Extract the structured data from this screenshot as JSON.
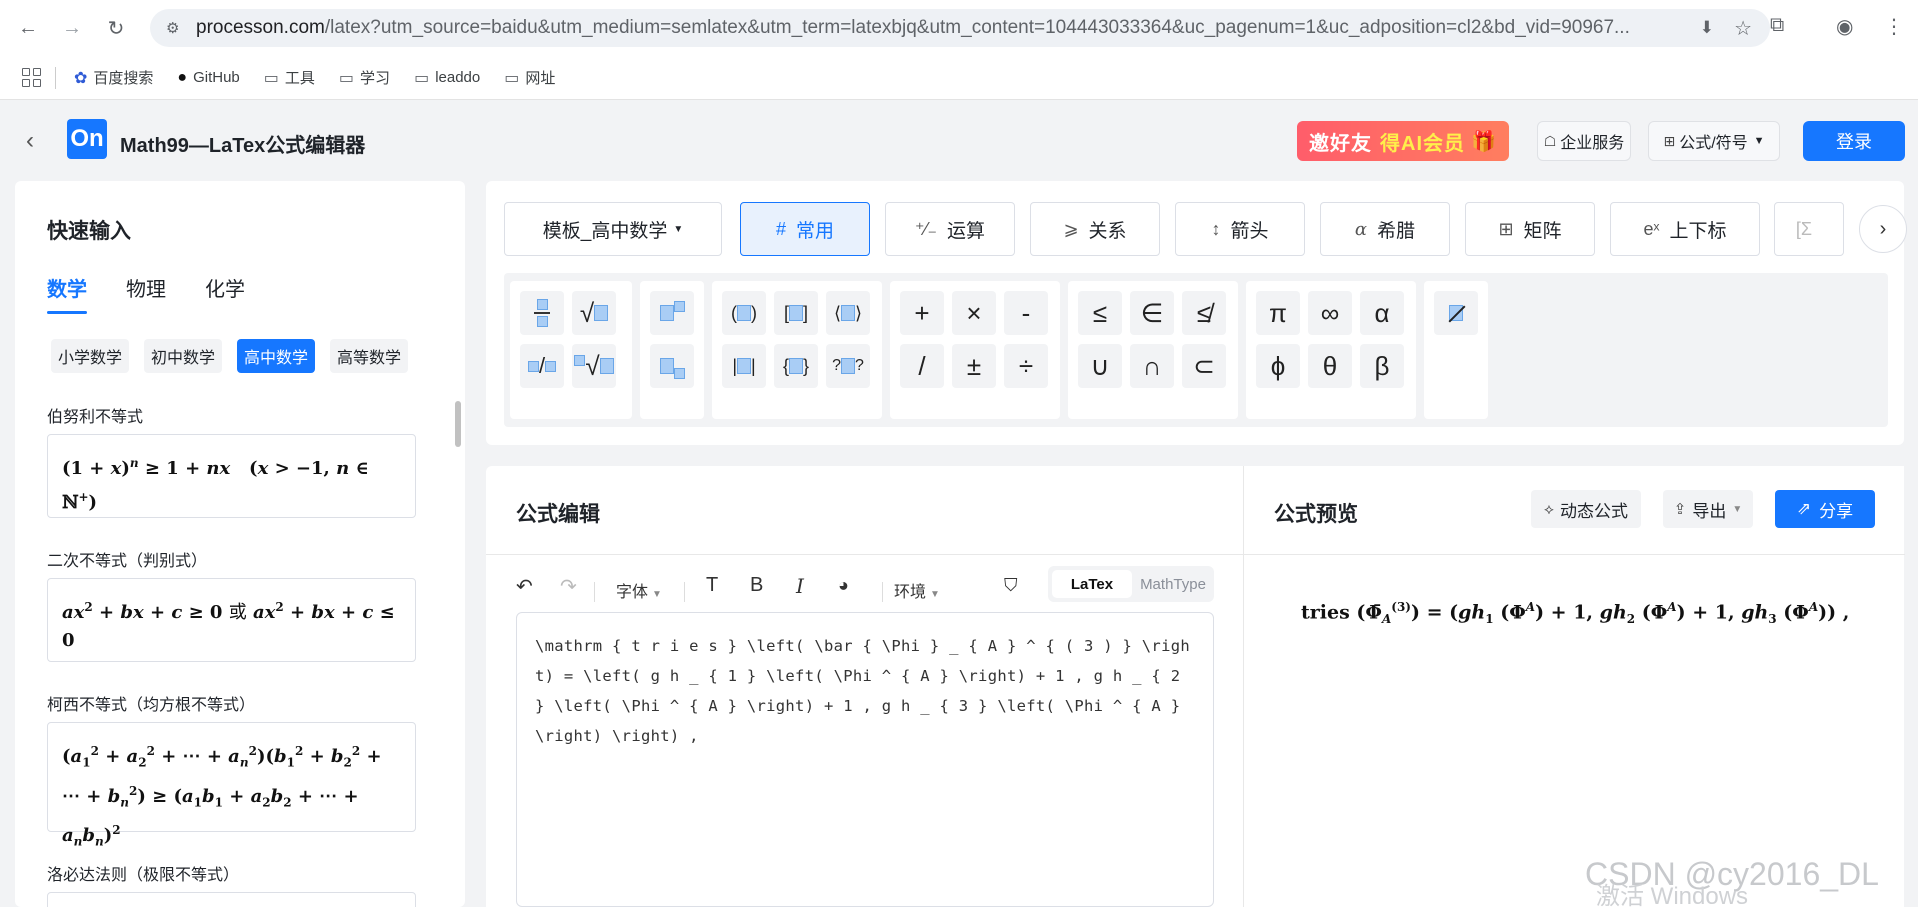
{
  "browser": {
    "url_main": "processon.com",
    "url_rest": "/latex?utm_source=baidu&utm_medium=semlatex&utm_term=latexbjq&utm_content=104443033364&uc_pagenum=1&uc_adposition=cl2&bd_vid=90967...",
    "bookmarks": [
      "百度搜索",
      "GitHub",
      "工具",
      "学习",
      "leaddo",
      "网址"
    ]
  },
  "header": {
    "logo": "On",
    "title": "Math99—LaTex公式编辑器",
    "invite_a": "邀好友",
    "invite_b": "得AI会员",
    "enterprise": "企业服务",
    "formula_symbols": "公式/符号",
    "login": "登录"
  },
  "left": {
    "title": "快速输入",
    "subjects": [
      "数学",
      "物理",
      "化学"
    ],
    "levels": [
      "小学数学",
      "初中数学",
      "高中数学",
      "高等数学"
    ],
    "formulas": [
      {
        "label": "伯努利不等式"
      },
      {
        "label": "二次不等式（判别式）",
        "text_or": "或"
      },
      {
        "label": "柯西不等式（均方根不等式）"
      },
      {
        "label": "洛必达法则（极限不等式）"
      }
    ]
  },
  "toolbar": {
    "template": "模板_高中数学",
    "tabs": [
      "常用",
      "运算",
      "关系",
      "箭头",
      "希腊",
      "矩阵",
      "上下标"
    ],
    "ops": [
      "+",
      "×",
      "-",
      "/",
      "±",
      "÷"
    ],
    "relations": [
      "≤",
      "∈",
      "≰",
      "∪",
      "∩",
      "⊂"
    ],
    "greek": [
      "π",
      "∞",
      "α",
      "ϕ",
      "θ",
      "β"
    ]
  },
  "editor": {
    "title": "公式编辑",
    "font": "字体",
    "env": "环境",
    "mode_latex": "LaTex",
    "mode_mathtype": "MathType",
    "code": "\\mathrm { t r i e s } \\left( \\bar { \\Phi } _ { A } ^ { ( 3 ) } \\right) = \\left( g h _ { 1 } \\left( \\Phi ^ { A } \\right) + 1 , g h _ { 2 } \\left( \\Phi ^ { A } \\right) + 1 , g h _ { 3 } \\left( \\Phi ^ { A } \\right) \\right) ,"
  },
  "preview": {
    "title": "公式预览",
    "dynamic": "动态公式",
    "export": "导出",
    "share": "分享"
  },
  "watermark": "CSDN @cy2016_DL",
  "watermark2": "激活 Windows"
}
